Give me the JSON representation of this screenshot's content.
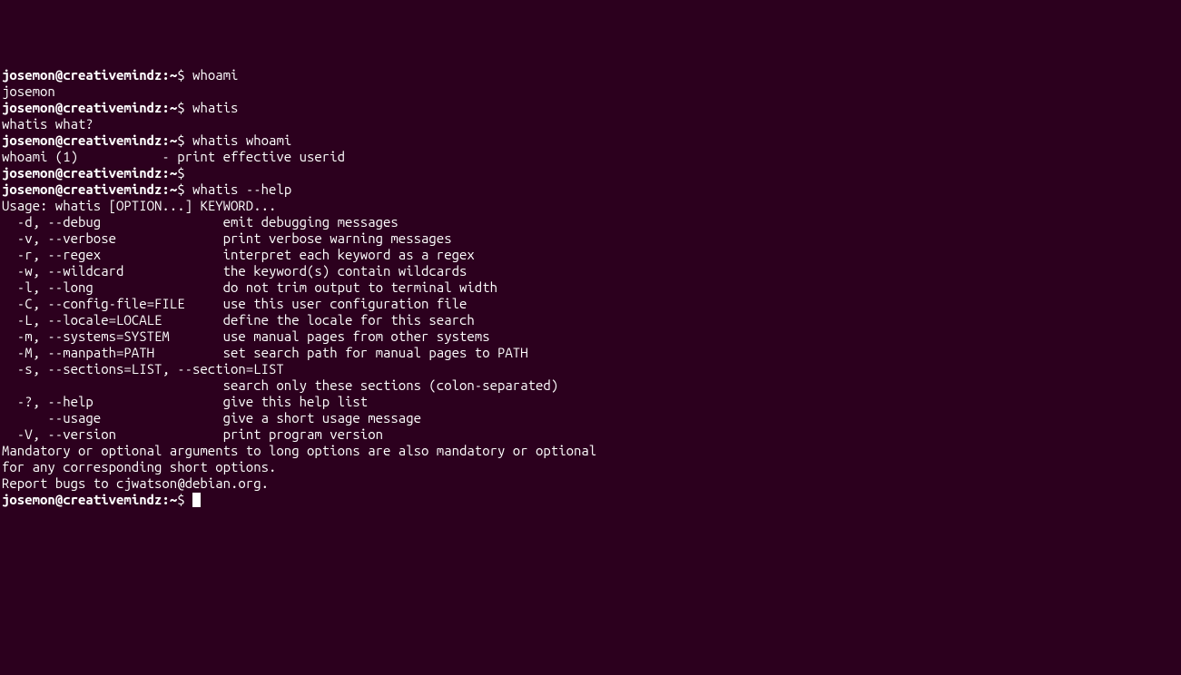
{
  "prompt": {
    "user": "josemon",
    "host": "creativemindz",
    "sep_uh": "@",
    "sep_hp": ":",
    "path": "~",
    "symbol": "$"
  },
  "session": {
    "cmd1": "whoami",
    "out1": "josemon",
    "cmd2": "whatis",
    "out2": "whatis what?",
    "cmd3": "whatis whoami",
    "out3": "whoami (1)           - print effective userid",
    "cmd4": "",
    "cmd5": "whatis --help",
    "help": {
      "usage": "Usage: whatis [OPTION...] KEYWORD...",
      "opts": [
        "  -d, --debug                emit debugging messages",
        "  -v, --verbose              print verbose warning messages",
        "  -r, --regex                interpret each keyword as a regex",
        "  -w, --wildcard             the keyword(s) contain wildcards",
        "  -l, --long                 do not trim output to terminal width",
        "  -C, --config-file=FILE     use this user configuration file",
        "  -L, --locale=LOCALE        define the locale for this search",
        "  -m, --systems=SYSTEM       use manual pages from other systems",
        "  -M, --manpath=PATH         set search path for manual pages to PATH",
        "  -s, --sections=LIST, --section=LIST",
        "                             search only these sections (colon-separated)",
        "  -?, --help                 give this help list",
        "      --usage                give a short usage message",
        "  -V, --version              print program version"
      ],
      "footer1": "Mandatory or optional arguments to long options are also mandatory or optional",
      "footer2": "for any corresponding short options.",
      "report": "Report bugs to cjwatson@debian.org."
    }
  }
}
